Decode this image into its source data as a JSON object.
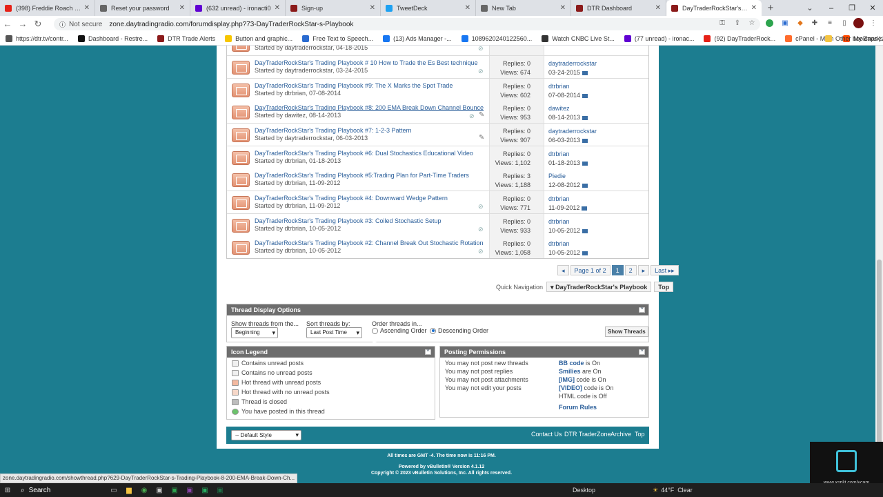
{
  "browser": {
    "tabs": [
      {
        "title": "(398) Freddie Roach RAW | ",
        "icon": "youtube-icon",
        "color": "#e62117"
      },
      {
        "title": "Reset your password",
        "icon": "globe-icon",
        "color": "#666666"
      },
      {
        "title": "(632 unread) - ironacti0",
        "icon": "yahoo-mail-icon",
        "color": "#6001d2"
      },
      {
        "title": "Sign-up",
        "icon": "star-icon",
        "color": "#8b1a1a"
      },
      {
        "title": "TweetDeck",
        "icon": "twitter-icon",
        "color": "#1da1f2"
      },
      {
        "title": "New Tab",
        "icon": "globe-icon",
        "color": "#666666"
      },
      {
        "title": "DTR Dashboard",
        "icon": "star-icon",
        "color": "#8b1a1a"
      },
      {
        "title": "DayTraderRockStar's Playb",
        "icon": "star-icon",
        "color": "#8b1a1a",
        "active": true
      }
    ],
    "not_secure": "Not secure",
    "url": "zone.daytradingradio.com/forumdisplay.php?73-DayTraderRockStar-s-Playbook",
    "bookmarks": [
      {
        "label": "https://dtr.tv/contr...",
        "color": "#555555"
      },
      {
        "label": "Dashboard - Restre...",
        "color": "#111111"
      },
      {
        "label": "DTR Trade Alerts",
        "color": "#8b1a1a"
      },
      {
        "label": "Button and graphic...",
        "color": "#f7c600"
      },
      {
        "label": "Free Text to Speech...",
        "color": "#2a6bd0"
      },
      {
        "label": "(13) Ads Manager -...",
        "color": "#1877f2"
      },
      {
        "label": "1089620240122560...",
        "color": "#1877f2"
      },
      {
        "label": "Watch CNBC Live St...",
        "color": "#333333"
      },
      {
        "label": "(77 unread) - ironac...",
        "color": "#6001d2"
      },
      {
        "label": "(92) DayTraderRock...",
        "color": "#e62117"
      },
      {
        "label": "cPanel - Main",
        "color": "#ff6c2c"
      },
      {
        "label": "My Zaps | Zapier",
        "color": "#ff4a00"
      }
    ],
    "other_bookmarks": "Other bookmarks",
    "status_url": "zone.daytradingradio.com/showthread.php?629-DayTraderRockStar-s-Trading-Playbook-8-200-EMA-Break-Down-Ch..."
  },
  "threads": [
    {
      "title": "",
      "starter": "Started by daytraderrockstar, 04-18-2015",
      "replies": "",
      "views": "",
      "last_user": "",
      "last_date": "",
      "attach": true,
      "partial": true
    },
    {
      "title": "DayTraderRockStar's Trading Playbook # 10 How to Trade the Es Best technique",
      "starter": "Started by daytraderrockstar, 03-24-2015",
      "replies": "Replies: 0",
      "views": "Views: 674",
      "last_user": "daytraderrockstar",
      "last_date": "03-24-2015",
      "attach": true
    },
    {
      "title": "DayTraderRockStar's Trading Playbook #9: The X Marks the Spot Trade",
      "starter": "Started by dtrbrian, 07-08-2014",
      "replies": "Replies: 0",
      "views": "Views: 602",
      "last_user": "dtrbrian",
      "last_date": "07-08-2014"
    },
    {
      "title": "DayTraderRockStar's Trading Playbook #8: 200 EMA Break Down Channel Bounce",
      "starter": "Started by dawitez, 08-14-2013",
      "replies": "Replies: 0",
      "views": "Views: 953",
      "last_user": "dawitez",
      "last_date": "08-14-2013",
      "attach": true,
      "pen": true,
      "underline": true
    },
    {
      "title": "DayTraderRockStar's Trading Playbook #7: 1-2-3 Pattern",
      "starter": "Started by daytraderrockstar, 06-03-2013",
      "replies": "Replies: 0",
      "views": "Views: 907",
      "last_user": "daytraderrockstar",
      "last_date": "06-03-2013",
      "pen": true
    },
    {
      "title": "DayTraderRockStar's Trading Playbook #6: Dual Stochastics Educational Video",
      "starter": "Started by dtrbrian, 01-18-2013",
      "replies": "Replies: 0",
      "views": "Views: 1,102",
      "last_user": "dtrbrian",
      "last_date": "01-18-2013"
    },
    {
      "title": "DayTraderRockStar's Trading Playbook #5:Trading Plan for Part-Time Traders",
      "starter": "Started by dtrbrian, 11-09-2012",
      "replies": "Replies: 3",
      "views": "Views: 1,188",
      "last_user": "Piedie",
      "last_date": "12-08-2012"
    },
    {
      "title": "DayTraderRockStar's Trading Playbook #4: Downward Wedge Pattern",
      "starter": "Started by dtrbrian, 11-09-2012",
      "replies": "Replies: 0",
      "views": "Views: 771",
      "last_user": "dtrbrian",
      "last_date": "11-09-2012",
      "attach": true
    },
    {
      "title": "DayTraderRockStar's Trading Playbook #3: Coiled Stochastic Setup",
      "starter": "Started by dtrbrian, 10-05-2012",
      "replies": "Replies: 0",
      "views": "Views: 933",
      "last_user": "dtrbrian",
      "last_date": "10-05-2012",
      "attach": true
    },
    {
      "title": "DayTraderRockStar's Trading Playbook #2: Channel Break Out Stochastic Rotation",
      "starter": "Started by dtrbrian, 10-05-2012",
      "replies": "Replies: 0",
      "views": "Views: 1,058",
      "last_user": "dtrbrian",
      "last_date": "10-05-2012",
      "attach": true
    }
  ],
  "pagination": {
    "prev": "◂",
    "page_of": "Page 1 of 2",
    "current": "1",
    "next_page": "2",
    "next": "▸",
    "last": "Last ▸▸"
  },
  "quick_nav": {
    "label": "Quick Navigation",
    "selected": "▾ DayTraderRockStar's Playbook",
    "top": "Top"
  },
  "display_options": {
    "title": "Thread Display Options",
    "show_label": "Show threads from the...",
    "show_value": "Beginning",
    "sort_label": "Sort threads by:",
    "sort_value": "Last Post Time",
    "order_label": "Order threads in...",
    "ascending": "Ascending Order",
    "descending": "Descending Order",
    "button": "Show Threads"
  },
  "icon_legend": {
    "title": "Icon Legend",
    "items": [
      "Contains unread posts",
      "Contains no unread posts",
      "Hot thread with unread posts",
      "Hot thread with no unread posts",
      "Thread is closed",
      "You have posted in this thread"
    ]
  },
  "posting_permissions": {
    "title": "Posting Permissions",
    "left": [
      "You may not post new threads",
      "You may not post replies",
      "You may not post attachments",
      "You may not edit your posts"
    ],
    "right": [
      {
        "key": "BB code",
        "rest": " is On"
      },
      {
        "key": "Smilies",
        "rest": " are On"
      },
      {
        "key": "[IMG]",
        "rest": " code is On"
      },
      {
        "key": "[VIDEO]",
        "rest": " code is On"
      },
      {
        "key": "",
        "rest": "HTML code is Off"
      }
    ],
    "rules": "Forum Rules"
  },
  "footer": {
    "style": "-- Default Style",
    "links": [
      "Contact Us",
      "DTR TraderZone",
      "Archive",
      "Top"
    ],
    "time": "All times are GMT -4. The time now is 11:16 PM.",
    "powered": "Powered by vBulletin® Version 4.1.12",
    "copyright": "Copyright © 2023 vBulletin Solutions, Inc. All rights reserved."
  },
  "taskbar": {
    "search": "Search",
    "desktop": "Desktop",
    "temp": "44°F",
    "weather": "Clear"
  },
  "overlay": {
    "vcam_url": "www.xsplit.com/vcam"
  }
}
